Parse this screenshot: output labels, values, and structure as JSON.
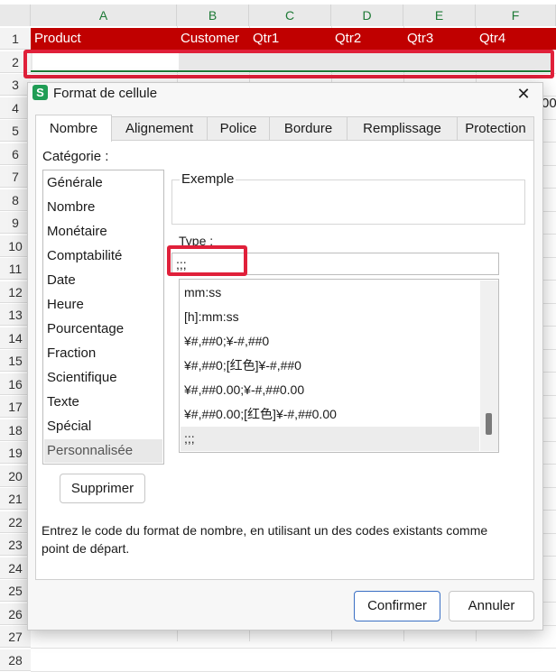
{
  "sheet": {
    "columns": [
      "A",
      "B",
      "C",
      "D",
      "E",
      "F"
    ],
    "rows": [
      "1",
      "2",
      "3",
      "4",
      "5",
      "6",
      "7",
      "8",
      "9",
      "10",
      "11",
      "12",
      "13",
      "14",
      "15",
      "16",
      "17",
      "18",
      "19",
      "20",
      "21",
      "22",
      "23",
      "24",
      "25",
      "26",
      "27",
      "28"
    ],
    "row1": [
      "Product",
      "Customer",
      "Qtr1",
      "Qtr2",
      "Qtr3",
      "Qtr4"
    ],
    "stray_text": "00",
    "header_band_color": "#c00000",
    "selection_color": "#e0203a"
  },
  "dialog": {
    "icon_letter": "S",
    "title": "Format de cellule",
    "close_glyph": "✕",
    "tabs": [
      "Nombre",
      "Alignement",
      "Police",
      "Bordure",
      "Remplissage",
      "Protection"
    ],
    "active_tab": "Nombre",
    "category_label": "Catégorie :",
    "categories": [
      "Générale",
      "Nombre",
      "Monétaire",
      "Comptabilité",
      "Date",
      "Heure",
      "Pourcentage",
      "Fraction",
      "Scientifique",
      "Texte",
      "Spécial",
      "Personnalisée"
    ],
    "selected_category": "Personnalisée",
    "example_label": "Exemple",
    "type_label": "Type :",
    "type_value": ";;;",
    "formats": [
      "mm:ss",
      "[h]:mm:ss",
      "¥#,##0;¥-#,##0",
      "¥#,##0;[红色]¥-#,##0",
      "¥#,##0.00;¥-#,##0.00",
      "¥#,##0.00;[红色]¥-#,##0.00",
      ";;;"
    ],
    "selected_format": ";;;",
    "delete_button": "Supprimer",
    "help_text": "Entrez le code du format de nombre, en utilisant un des codes existants comme point de départ.",
    "confirm_button": "Confirmer",
    "cancel_button": "Annuler",
    "brand_color": "#1f9d55"
  }
}
